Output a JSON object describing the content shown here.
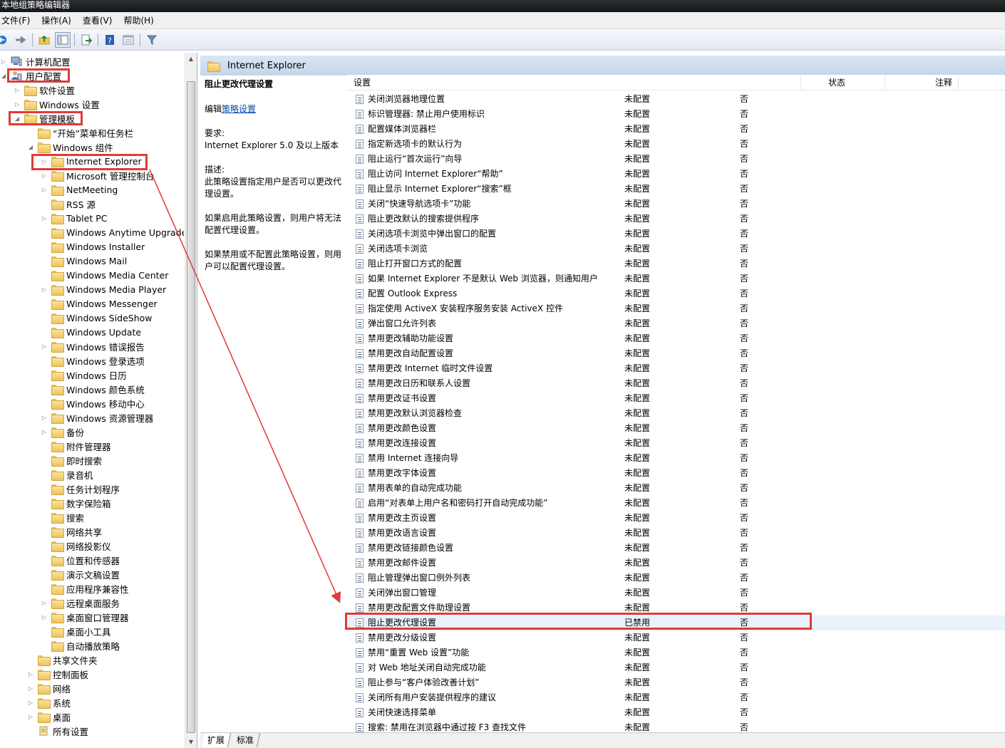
{
  "window": {
    "title": "本地组策略编辑器"
  },
  "menu": [
    "文件(F)",
    "操作(A)",
    "查看(V)",
    "帮助(H)"
  ],
  "toolbar": [
    "back-icon",
    "forward-icon",
    "up-folder-icon",
    "show-hide-tree-icon",
    "export-list-icon",
    "help-icon",
    "properties-icon",
    "filter-icon"
  ],
  "tree": [
    {
      "label": "计算机配置",
      "depth": 0,
      "expander": "▷",
      "icon": "computer"
    },
    {
      "label": "用户配置",
      "depth": 0,
      "expander": "◢",
      "icon": "user"
    },
    {
      "label": "软件设置",
      "depth": 1,
      "expander": "▷",
      "icon": "folder"
    },
    {
      "label": "Windows 设置",
      "depth": 1,
      "expander": "▷",
      "icon": "folder"
    },
    {
      "label": "管理模板",
      "depth": 1,
      "expander": "◢",
      "icon": "folder"
    },
    {
      "label": "“开始”菜单和任务栏",
      "depth": 2,
      "expander": "",
      "icon": "folder"
    },
    {
      "label": "Windows 组件",
      "depth": 2,
      "expander": "◢",
      "icon": "folder"
    },
    {
      "label": "Internet Explorer",
      "depth": 3,
      "expander": "▷",
      "icon": "folder"
    },
    {
      "label": "Microsoft 管理控制台",
      "depth": 3,
      "expander": "▷",
      "icon": "folder"
    },
    {
      "label": "NetMeeting",
      "depth": 3,
      "expander": "▷",
      "icon": "folder"
    },
    {
      "label": "RSS 源",
      "depth": 3,
      "expander": "",
      "icon": "folder"
    },
    {
      "label": "Tablet PC",
      "depth": 3,
      "expander": "▷",
      "icon": "folder"
    },
    {
      "label": "Windows Anytime Upgrade",
      "depth": 3,
      "expander": "",
      "icon": "folder"
    },
    {
      "label": "Windows Installer",
      "depth": 3,
      "expander": "",
      "icon": "folder"
    },
    {
      "label": "Windows Mail",
      "depth": 3,
      "expander": "",
      "icon": "folder"
    },
    {
      "label": "Windows Media Center",
      "depth": 3,
      "expander": "",
      "icon": "folder"
    },
    {
      "label": "Windows Media Player",
      "depth": 3,
      "expander": "▷",
      "icon": "folder"
    },
    {
      "label": "Windows Messenger",
      "depth": 3,
      "expander": "",
      "icon": "folder"
    },
    {
      "label": "Windows SideShow",
      "depth": 3,
      "expander": "",
      "icon": "folder"
    },
    {
      "label": "Windows Update",
      "depth": 3,
      "expander": "",
      "icon": "folder"
    },
    {
      "label": "Windows 错误报告",
      "depth": 3,
      "expander": "▷",
      "icon": "folder"
    },
    {
      "label": "Windows 登录选项",
      "depth": 3,
      "expander": "",
      "icon": "folder"
    },
    {
      "label": "Windows 日历",
      "depth": 3,
      "expander": "",
      "icon": "folder"
    },
    {
      "label": "Windows 颜色系统",
      "depth": 3,
      "expander": "",
      "icon": "folder"
    },
    {
      "label": "Windows 移动中心",
      "depth": 3,
      "expander": "",
      "icon": "folder"
    },
    {
      "label": "Windows 资源管理器",
      "depth": 3,
      "expander": "▷",
      "icon": "folder"
    },
    {
      "label": "备份",
      "depth": 3,
      "expander": "▷",
      "icon": "folder"
    },
    {
      "label": "附件管理器",
      "depth": 3,
      "expander": "",
      "icon": "folder"
    },
    {
      "label": "即时搜索",
      "depth": 3,
      "expander": "",
      "icon": "folder"
    },
    {
      "label": "录音机",
      "depth": 3,
      "expander": "",
      "icon": "folder"
    },
    {
      "label": "任务计划程序",
      "depth": 3,
      "expander": "",
      "icon": "folder"
    },
    {
      "label": "数字保险箱",
      "depth": 3,
      "expander": "",
      "icon": "folder"
    },
    {
      "label": "搜索",
      "depth": 3,
      "expander": "",
      "icon": "folder"
    },
    {
      "label": "网络共享",
      "depth": 3,
      "expander": "",
      "icon": "folder"
    },
    {
      "label": "网络投影仪",
      "depth": 3,
      "expander": "",
      "icon": "folder"
    },
    {
      "label": "位置和传感器",
      "depth": 3,
      "expander": "",
      "icon": "folder"
    },
    {
      "label": "演示文稿设置",
      "depth": 3,
      "expander": "",
      "icon": "folder"
    },
    {
      "label": "应用程序兼容性",
      "depth": 3,
      "expander": "",
      "icon": "folder"
    },
    {
      "label": "远程桌面服务",
      "depth": 3,
      "expander": "▷",
      "icon": "folder"
    },
    {
      "label": "桌面窗口管理器",
      "depth": 3,
      "expander": "▷",
      "icon": "folder"
    },
    {
      "label": "桌面小工具",
      "depth": 3,
      "expander": "",
      "icon": "folder"
    },
    {
      "label": "自动播放策略",
      "depth": 3,
      "expander": "",
      "icon": "folder"
    },
    {
      "label": "共享文件夹",
      "depth": 2,
      "expander": "",
      "icon": "folder"
    },
    {
      "label": "控制面板",
      "depth": 2,
      "expander": "▷",
      "icon": "folder"
    },
    {
      "label": "网络",
      "depth": 2,
      "expander": "▷",
      "icon": "folder"
    },
    {
      "label": "系统",
      "depth": 2,
      "expander": "▷",
      "icon": "folder"
    },
    {
      "label": "桌面",
      "depth": 2,
      "expander": "▷",
      "icon": "folder"
    },
    {
      "label": "所有设置",
      "depth": 2,
      "expander": "",
      "icon": "settings"
    }
  ],
  "right": {
    "header": "Internet Explorer",
    "description": {
      "title": "阻止更改代理设置",
      "edit_prefix": "编辑",
      "edit_link": "策略设置",
      "req_label": "要求:",
      "req_text": "Internet Explorer 5.0 及以上版本",
      "desc_label": "描述:",
      "desc_text": "此策略设置指定用户是否可以更改代理设置。",
      "enabled_text": "如果启用此策略设置，则用户将无法配置代理设置。",
      "disabled_text": "如果禁用或不配置此策略设置，则用户可以配置代理设置。"
    },
    "columns": [
      "设置",
      "状态",
      "注释"
    ],
    "rows": [
      [
        "关闭浏览器地理位置",
        "未配置",
        "否"
      ],
      [
        "标识管理器: 禁止用户使用标识",
        "未配置",
        "否"
      ],
      [
        "配置媒体浏览器栏",
        "未配置",
        "否"
      ],
      [
        "指定新选项卡的默认行为",
        "未配置",
        "否"
      ],
      [
        "阻止运行“首次运行”向导",
        "未配置",
        "否"
      ],
      [
        "阻止访问 Internet Explorer“帮助”",
        "未配置",
        "否"
      ],
      [
        "阻止显示 Internet Explorer“搜索”框",
        "未配置",
        "否"
      ],
      [
        "关闭“快速导航选项卡”功能",
        "未配置",
        "否"
      ],
      [
        "阻止更改默认的搜索提供程序",
        "未配置",
        "否"
      ],
      [
        "关闭选项卡浏览中弹出窗口的配置",
        "未配置",
        "否"
      ],
      [
        "关闭选项卡浏览",
        "未配置",
        "否"
      ],
      [
        "阻止打开窗口方式的配置",
        "未配置",
        "否"
      ],
      [
        "如果 Internet Explorer 不是默认 Web 浏览器，则通知用户",
        "未配置",
        "否"
      ],
      [
        "配置 Outlook Express",
        "未配置",
        "否"
      ],
      [
        "指定使用 ActiveX 安装程序服务安装 ActiveX 控件",
        "未配置",
        "否"
      ],
      [
        "弹出窗口允许列表",
        "未配置",
        "否"
      ],
      [
        "禁用更改辅助功能设置",
        "未配置",
        "否"
      ],
      [
        "禁用更改自动配置设置",
        "未配置",
        "否"
      ],
      [
        "禁用更改 Internet 临时文件设置",
        "未配置",
        "否"
      ],
      [
        "禁用更改日历和联系人设置",
        "未配置",
        "否"
      ],
      [
        "禁用更改证书设置",
        "未配置",
        "否"
      ],
      [
        "禁用更改默认浏览器检查",
        "未配置",
        "否"
      ],
      [
        "禁用更改颜色设置",
        "未配置",
        "否"
      ],
      [
        "禁用更改连接设置",
        "未配置",
        "否"
      ],
      [
        "禁用 Internet 连接向导",
        "未配置",
        "否"
      ],
      [
        "禁用更改字体设置",
        "未配置",
        "否"
      ],
      [
        "禁用表单的自动完成功能",
        "未配置",
        "否"
      ],
      [
        "启用“对表单上用户名和密码打开自动完成功能”",
        "未配置",
        "否"
      ],
      [
        "禁用更改主页设置",
        "未配置",
        "否"
      ],
      [
        "禁用更改语言设置",
        "未配置",
        "否"
      ],
      [
        "禁用更改链接颜色设置",
        "未配置",
        "否"
      ],
      [
        "禁用更改邮件设置",
        "未配置",
        "否"
      ],
      [
        "阻止管理弹出窗口例外列表",
        "未配置",
        "否"
      ],
      [
        "关闭弹出窗口管理",
        "未配置",
        "否"
      ],
      [
        "禁用更改配置文件助理设置",
        "未配置",
        "否"
      ],
      [
        "阻止更改代理设置",
        "已禁用",
        "否"
      ],
      [
        "禁用更改分级设置",
        "未配置",
        "否"
      ],
      [
        "禁用“重置 Web 设置”功能",
        "未配置",
        "否"
      ],
      [
        "对 Web 地址关闭自动完成功能",
        "未配置",
        "否"
      ],
      [
        "阻止参与“客户体验改善计划”",
        "未配置",
        "否"
      ],
      [
        "关闭所有用户安装提供程序的建议",
        "未配置",
        "否"
      ],
      [
        "关闭快速选择菜单",
        "未配置",
        "否"
      ],
      [
        "搜索: 禁用在浏览器中通过按 F3 查找文件",
        "未配置",
        "否"
      ]
    ],
    "selected_row": 35
  },
  "tabs": [
    "扩展",
    "标准"
  ],
  "colors": {
    "annotation": "#e03a3a",
    "header": "#c4d4e9",
    "link": "#0645ad"
  }
}
